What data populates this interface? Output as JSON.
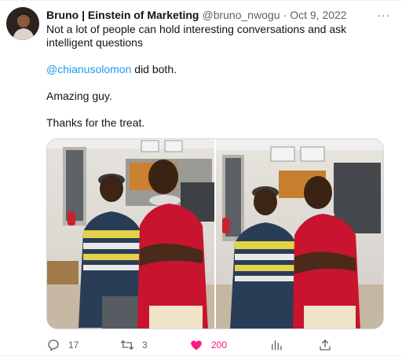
{
  "tweet": {
    "display_name": "Bruno | Einstein of Marketing",
    "handle": "@bruno_nwogu",
    "separator": "·",
    "date": "Oct 9, 2022",
    "more_label": "···",
    "text_line1": "Not a lot of people can hold interesting conversations and ask intelligent questions",
    "mention": "@chianusolomon",
    "mention_suffix": " did both.",
    "text_line3": "Amazing guy.",
    "text_line4": "Thanks for the treat."
  },
  "actions": {
    "reply_count": "17",
    "retweet_count": "3",
    "like_count": "200"
  },
  "colors": {
    "accent": "#1d9bf0",
    "like": "#f91880",
    "muted": "#536471"
  },
  "icons": [
    "more-icon",
    "reply-icon",
    "retweet-icon",
    "like-icon",
    "views-icon",
    "share-icon"
  ]
}
